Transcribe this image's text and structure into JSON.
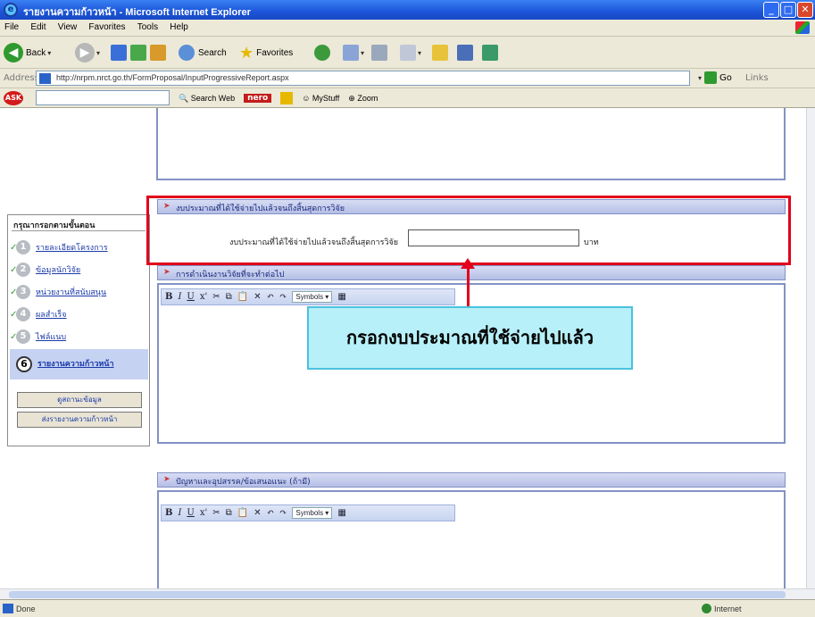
{
  "window": {
    "title": "รายงานความก้าวหน้า - Microsoft Internet Explorer",
    "controls": {
      "minimize": "_",
      "maximize": "□",
      "close": "✕"
    }
  },
  "menu": [
    "File",
    "Edit",
    "View",
    "Favorites",
    "Tools",
    "Help"
  ],
  "toolbar": {
    "back": "Back",
    "search": "Search",
    "favorites": "Favorites"
  },
  "address": {
    "label": "Address",
    "url": "http://nrpm.nrct.go.th/FormProposal/InputProgressiveReport.aspx",
    "go": "Go",
    "links": "Links"
  },
  "searchbar": {
    "search_web": "Search Web",
    "nero": "nero",
    "mystuff": "MyStuff",
    "zoom": "Zoom"
  },
  "sidebar": {
    "header": "กรุณากรอกตามขั้นตอน",
    "steps": [
      {
        "num": "1",
        "label": "รายละเอียดโครงการ",
        "done": true
      },
      {
        "num": "2",
        "label": "ข้อมูลนักวิจัย",
        "done": true
      },
      {
        "num": "3",
        "label": "หน่วยงานที่สนับสนุน",
        "done": true
      },
      {
        "num": "4",
        "label": "ผลสำเร็จ",
        "done": true
      },
      {
        "num": "5",
        "label": "ไฟล์แนบ",
        "done": true
      },
      {
        "num": "6",
        "label": "รายงานความก้าวหน้า",
        "done": false
      }
    ],
    "buttons": [
      "ดูสถานะข้อมูล",
      "ส่งรายงานความก้าวหน้า"
    ]
  },
  "sections": {
    "budget_header": "งบประมาณที่ได้ใช้จ่ายไปแล้วจนถึงสิ้นสุดการวิจัย",
    "budget_label": "งบประมาณที่ได้ใช้จ่ายไปแล้วจนถึงสิ้นสุดการวิจัย",
    "budget_value": "",
    "budget_unit": "บาท",
    "plan_header": "การดำเนินงานวิจัยที่จะทำต่อไป",
    "problems_header": "ปัญหาและอุปสรรค/ข้อเสนอแนะ (ถ้ามี)"
  },
  "editor": {
    "bold": "B",
    "italic": "I",
    "underline": "U",
    "symbols": "Symbols"
  },
  "callout": "กรอกงบประมาณที่ใช้จ่ายไปแล้ว",
  "status": {
    "left": "Done",
    "zone": "Internet"
  },
  "colors": {
    "highlight": "#e2001a",
    "callout_bg": "#b7f0f8",
    "header_bar": "#b5bfe6"
  }
}
